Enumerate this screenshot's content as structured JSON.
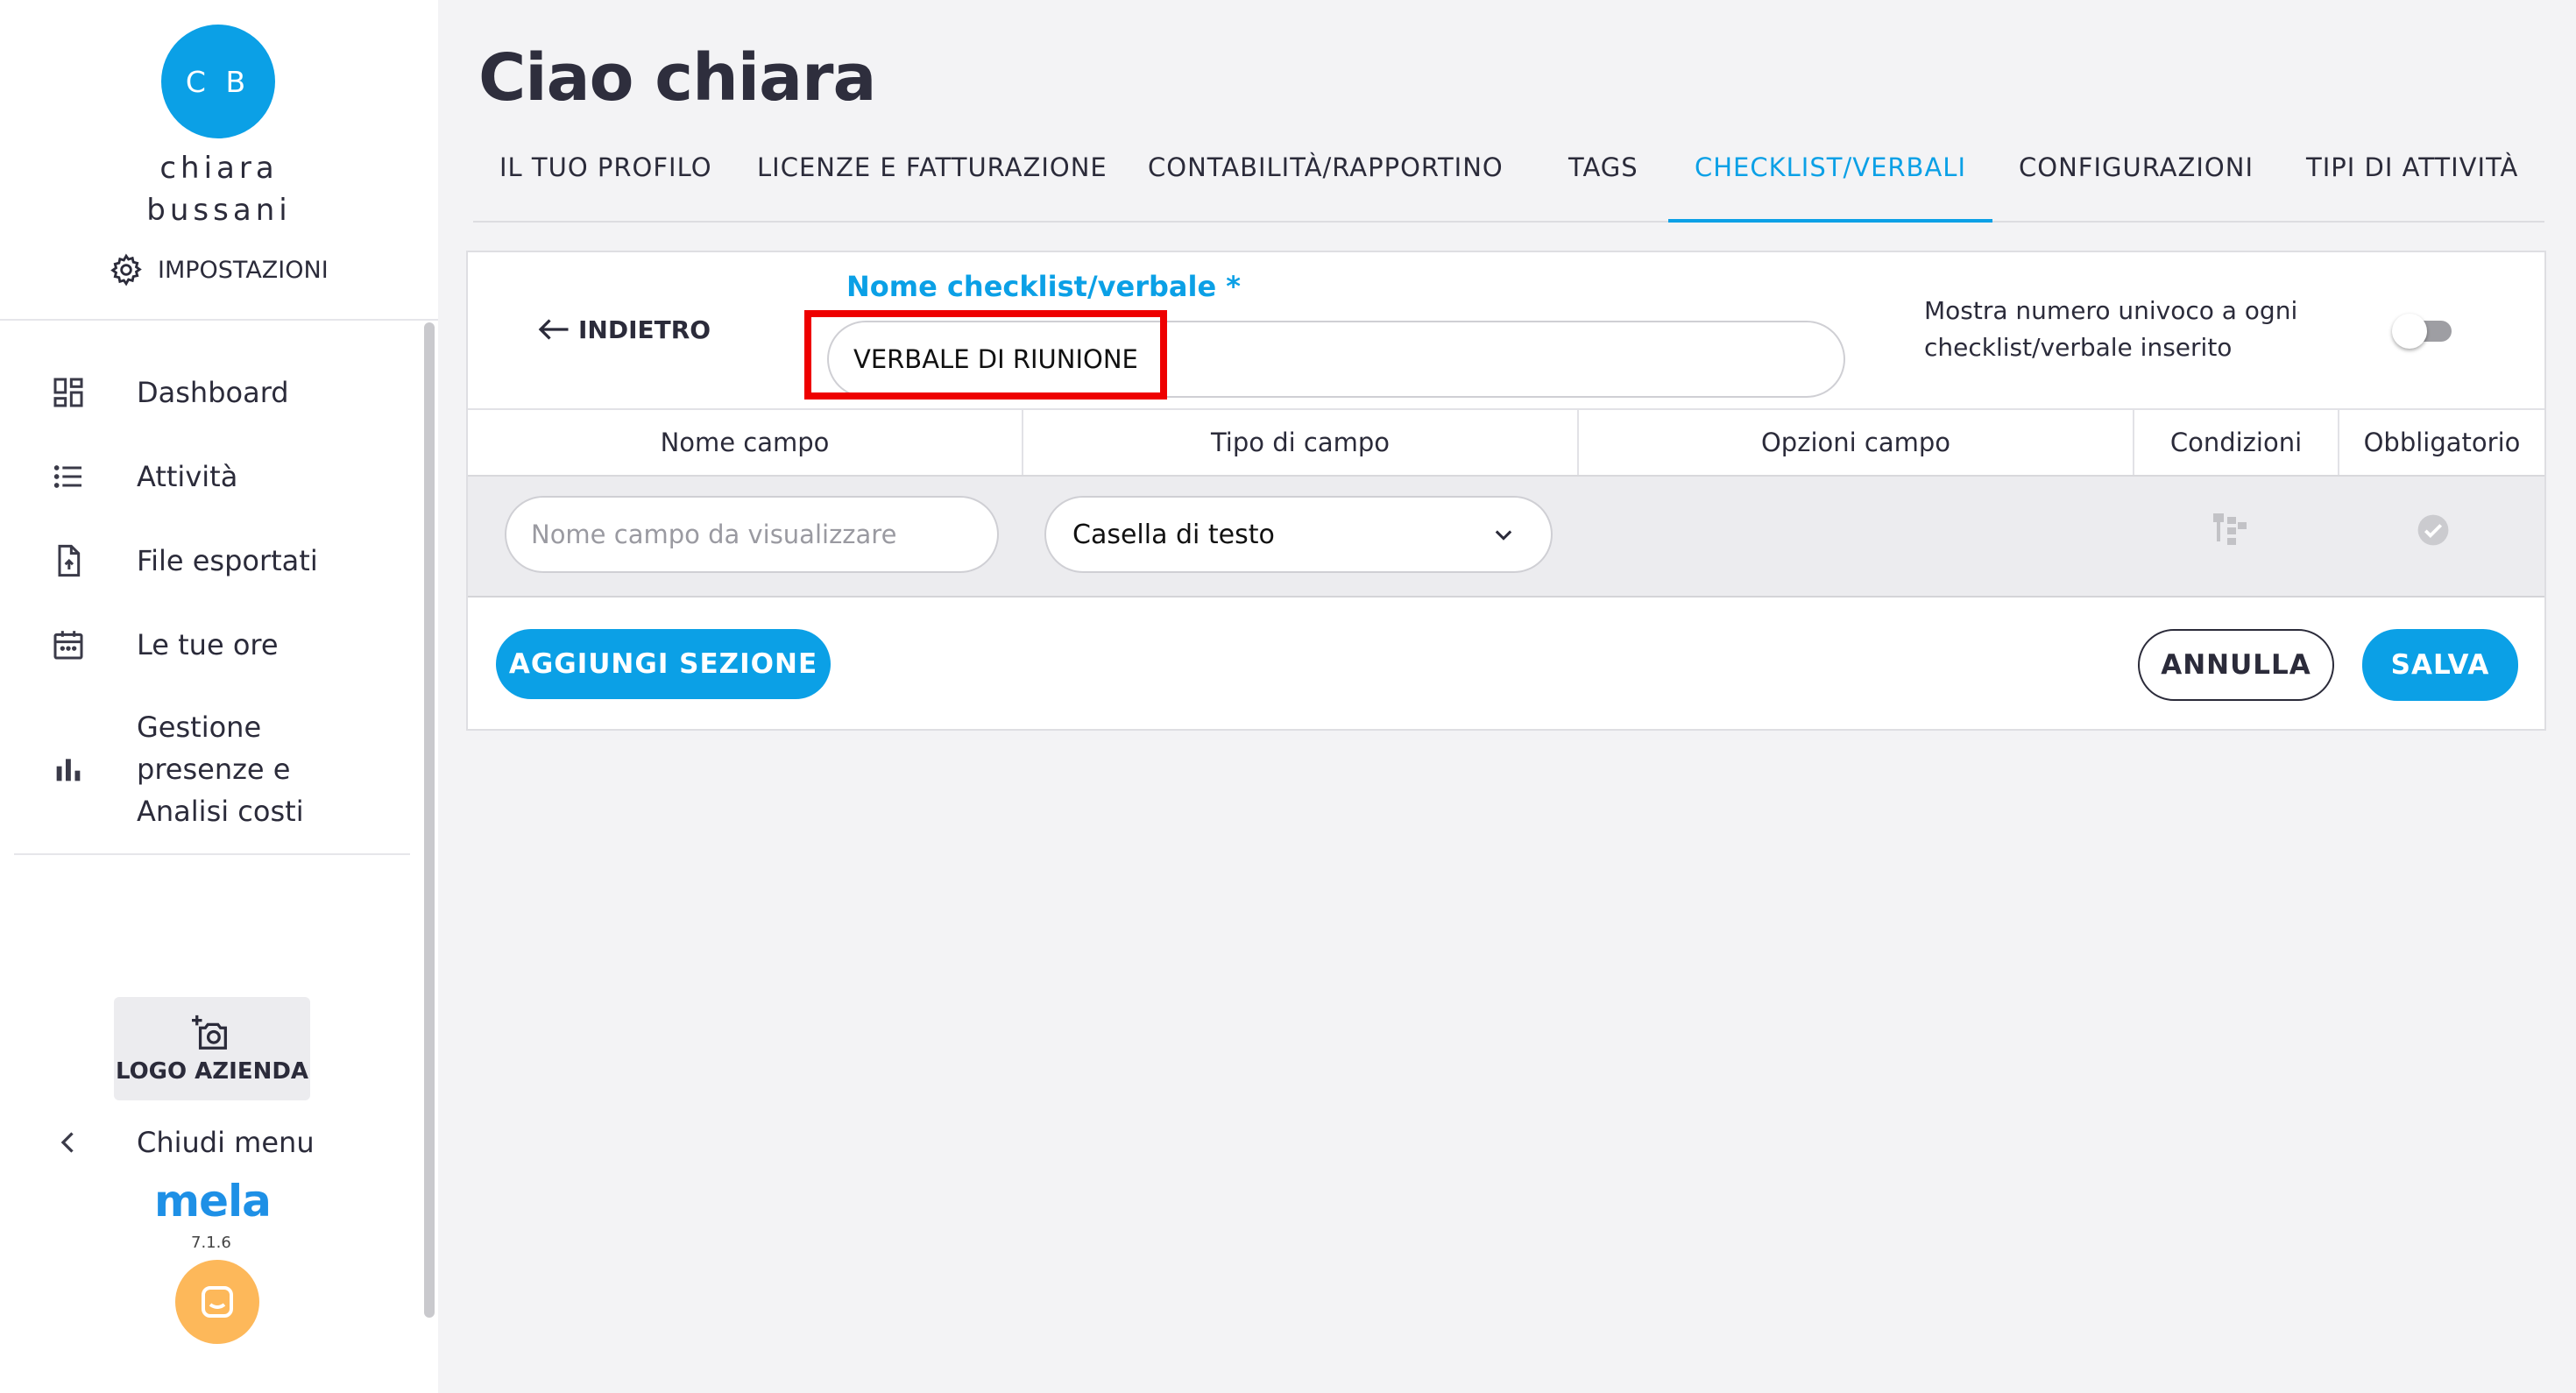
{
  "sidebar": {
    "avatar_initials": "C B",
    "user_first_name": "chiara",
    "user_last_name": "bussani",
    "settings_label": "IMPOSTAZIONI",
    "items": [
      {
        "label": "Dashboard",
        "icon": "dashboard-icon"
      },
      {
        "label": "Attività",
        "icon": "list-icon"
      },
      {
        "label": "File esportati",
        "icon": "file-export-icon"
      },
      {
        "label": "Le tue ore",
        "icon": "calendar-icon"
      },
      {
        "label": "Gestione\npresenze e\nAnalisi costi",
        "icon": "bar-chart-icon"
      }
    ],
    "logo_button_label": "LOGO AZIENDA",
    "close_menu_label": "Chiudi menu",
    "brand": "mela",
    "version": "7.1.6"
  },
  "header": {
    "title": "Ciao chiara",
    "tabs": [
      {
        "label": "IL TUO PROFILO",
        "active": false
      },
      {
        "label": "LICENZE E FATTURAZIONE",
        "active": false
      },
      {
        "label": "CONTABILITÀ/RAPPORTINO",
        "active": false
      },
      {
        "label": "TAGS",
        "active": false
      },
      {
        "label": "CHECKLIST/VERBALI",
        "active": true
      },
      {
        "label": "CONFIGURAZIONI",
        "active": false
      },
      {
        "label": "TIPI DI ATTIVITÀ",
        "active": false
      }
    ]
  },
  "form": {
    "back_label": "INDIETRO",
    "name_label": "Nome checklist/verbale *",
    "name_value": "VERBALE DI RIUNIONE",
    "toggle_label": "Mostra numero univoco a ogni checklist/verbale inserito",
    "toggle_on": false,
    "table": {
      "columns": [
        "Nome campo",
        "Tipo di campo",
        "Opzioni campo",
        "Condizioni",
        "Obbligatorio"
      ],
      "row": {
        "name_placeholder": "Nome campo da visualizzare",
        "type_value": "Casella di testo"
      }
    },
    "add_section_label": "AGGIUNGI SEZIONE",
    "cancel_label": "ANNULLA",
    "save_label": "SALVA"
  },
  "colors": {
    "accent": "#0ba0e6",
    "highlight": "#ee0000",
    "chat": "#fdb85a"
  }
}
